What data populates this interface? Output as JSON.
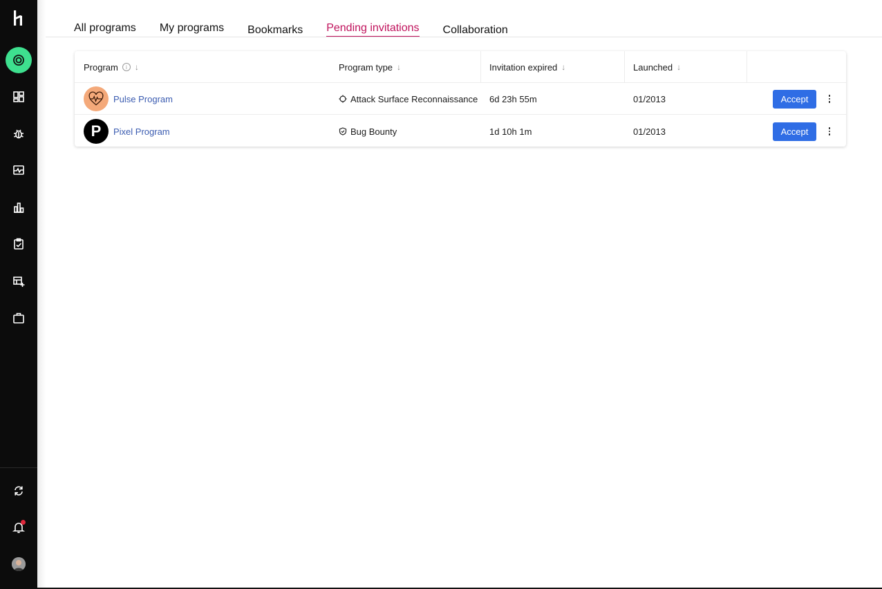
{
  "tabs": [
    {
      "label": "All programs"
    },
    {
      "label": "My programs"
    },
    {
      "label": "Bookmarks"
    },
    {
      "label": "Pending invitations",
      "active": true
    },
    {
      "label": "Collaboration"
    }
  ],
  "table": {
    "columns": [
      "Program",
      "Program type",
      "Invitation expired",
      "Launched"
    ],
    "rows": [
      {
        "program": "Pulse Program",
        "avatar_icon": "heart-pulse-icon",
        "avatar_color": "#f4a97a",
        "type": "Attack Surface Reconnaissance",
        "type_icon": "crosshair-icon",
        "expires": "6d 23h 55m",
        "launched": "01/2013",
        "action": "Accept"
      },
      {
        "program": "Pixel Program",
        "avatar_icon": "letter-p-logo",
        "avatar_letter": "P",
        "avatar_color": "#000000",
        "type": "Bug Bounty",
        "type_icon": "shield-icon",
        "expires": "1d 10h 1m",
        "launched": "01/2013",
        "action": "Accept"
      }
    ]
  },
  "sidebar": {
    "items": [
      "target-icon",
      "dashboard-icon",
      "bug-icon",
      "activity-icon",
      "bar-chart-icon",
      "clipboard-check-icon",
      "add-program-icon",
      "briefcase-icon"
    ],
    "bottom": [
      "sync-icon",
      "bell-icon",
      "user-avatar"
    ]
  },
  "colors": {
    "accent": "#c0125c",
    "button": "#2f6de5",
    "active_nav": "#3ee08f",
    "link": "#3a5bb0"
  }
}
